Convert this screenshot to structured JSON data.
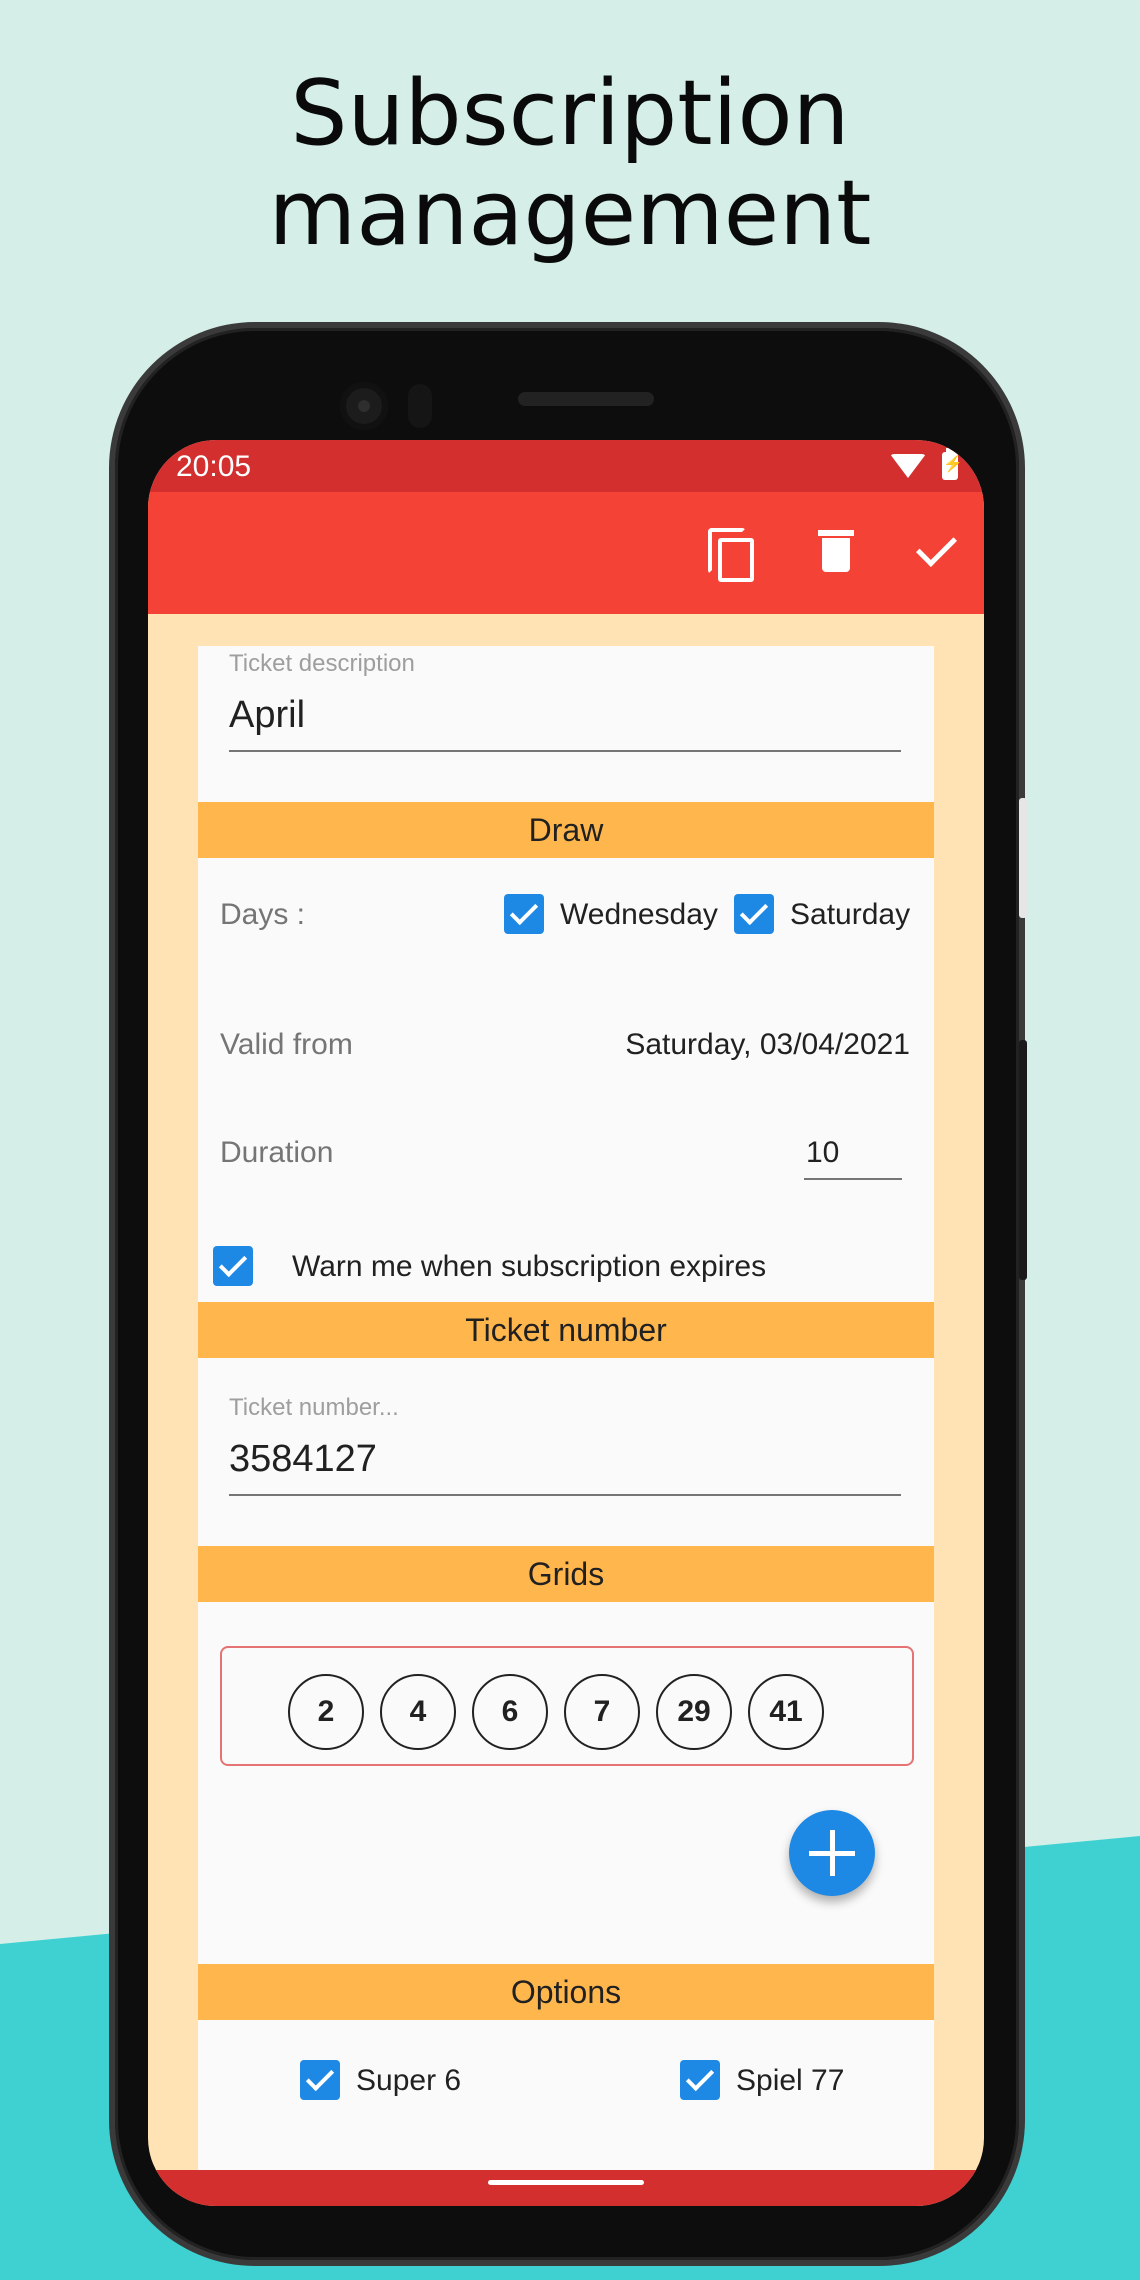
{
  "promo": {
    "title_line1": "Subscription",
    "title_line2": "management"
  },
  "status_bar": {
    "time": "20:05"
  },
  "app_bar": {
    "actions": [
      "copy-icon",
      "delete-icon",
      "check-icon"
    ]
  },
  "ticket_description": {
    "label": "Ticket description",
    "value": "April"
  },
  "draw": {
    "header": "Draw",
    "days_label": "Days :",
    "days": [
      {
        "label": "Wednesday",
        "checked": true
      },
      {
        "label": "Saturday",
        "checked": true
      }
    ],
    "valid_from_label": "Valid from",
    "valid_from_value": "Saturday, 03/04/2021",
    "duration_label": "Duration",
    "duration_value": "10",
    "warn_label": "Warn me when subscription expires",
    "warn_checked": true
  },
  "ticket_number": {
    "header": "Ticket number",
    "label": "Ticket number...",
    "value": "3584127"
  },
  "grids": {
    "header": "Grids",
    "numbers": [
      "2",
      "4",
      "6",
      "7",
      "29",
      "41"
    ]
  },
  "options": {
    "header": "Options",
    "items": [
      {
        "label": "Super 6",
        "checked": true
      },
      {
        "label": "Spiel 77",
        "checked": true
      }
    ]
  },
  "colors": {
    "status_bar": "#d32f2f",
    "app_bar": "#f44336",
    "section_header": "#ffb74d",
    "screen_bg": "#ffe3b5",
    "accent": "#1e88e5",
    "grid_border": "#e57373",
    "teal": "#3fd1d1",
    "mint": "#d5efe8"
  }
}
